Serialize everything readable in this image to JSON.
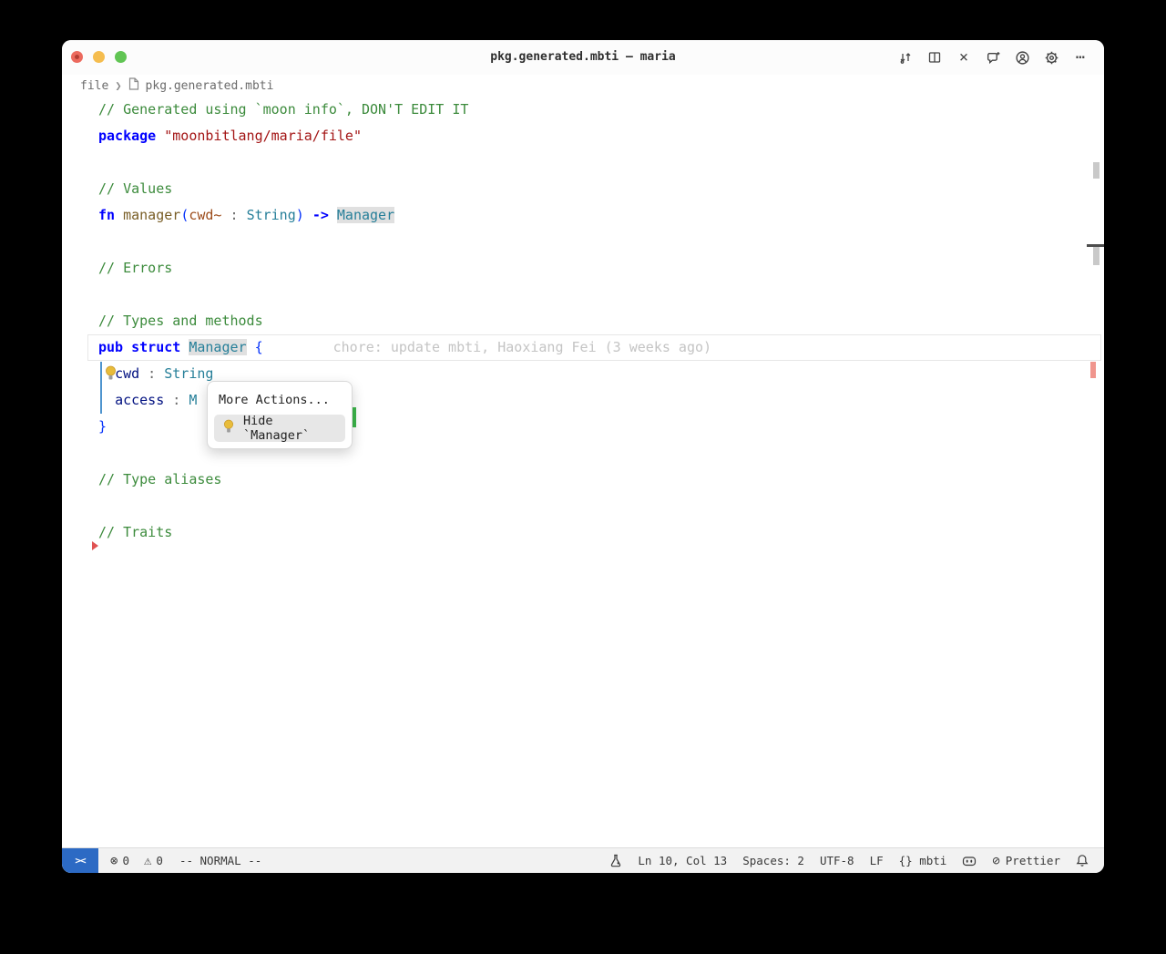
{
  "theme": {
    "window_bg": "#ffffff",
    "desktop_bg": "#000000",
    "statusbar_bg": "#f2f2f2",
    "remote_indicator_bg": "#2c6ac4",
    "word_highlight": "#e0e0e0",
    "current_line_border": "#e7e7e7",
    "popup_item_bg": "#e7e7e7",
    "traffic_red": "#ec6a5e",
    "traffic_yellow": "#f5bd4f",
    "traffic_green": "#61c554",
    "green_highlight": "#3cb54a",
    "overview_error_mark": "#f0958d"
  },
  "titlebar": {
    "title": "pkg.generated.mbti — maria",
    "icon_names": [
      "compare-changes",
      "split-editor",
      "close",
      "chat-add",
      "account",
      "settings",
      "more-actions"
    ]
  },
  "breadcrumb": {
    "folder": "file",
    "chevron": "❯",
    "file": "pkg.generated.mbti"
  },
  "editor": {
    "syntax_colors": {
      "comment": "#3c8b3c",
      "keyword": "#0000ff",
      "string": "#a31515",
      "func": "#795e26",
      "param": "#9c4c1b",
      "type": "#267f99",
      "field": "#001080",
      "punct": "#6a6a6a",
      "brace": "#0431fa",
      "op": "#0000ff",
      "plain": "#000000",
      "blame": "#c4c4c4"
    },
    "lines": [
      {
        "segments": [
          {
            "t": "// Generated using `moon info`, DON'T EDIT IT",
            "c": "comment"
          }
        ]
      },
      {
        "segments": [
          {
            "t": "package",
            "c": "keyword"
          },
          {
            "t": " ",
            "c": "plain"
          },
          {
            "t": "\"moonbitlang/maria/file\"",
            "c": "string"
          }
        ]
      },
      {
        "segments": []
      },
      {
        "segments": [
          {
            "t": "// Values",
            "c": "comment"
          }
        ]
      },
      {
        "segments": [
          {
            "t": "fn",
            "c": "keyword"
          },
          {
            "t": " ",
            "c": "plain"
          },
          {
            "t": "manager",
            "c": "func"
          },
          {
            "t": "(",
            "c": "brace"
          },
          {
            "t": "cwd~",
            "c": "param"
          },
          {
            "t": " : ",
            "c": "punct"
          },
          {
            "t": "String",
            "c": "type"
          },
          {
            "t": ")",
            "c": "brace"
          },
          {
            "t": " ",
            "c": "plain"
          },
          {
            "t": "->",
            "c": "op"
          },
          {
            "t": " ",
            "c": "plain"
          },
          {
            "t": "Manager",
            "c": "type",
            "hl": true
          }
        ]
      },
      {
        "segments": []
      },
      {
        "segments": [
          {
            "t": "// Errors",
            "c": "comment"
          }
        ]
      },
      {
        "segments": []
      },
      {
        "segments": [
          {
            "t": "// Types and methods",
            "c": "comment"
          }
        ]
      },
      {
        "segments": [
          {
            "t": "pub struct",
            "c": "keyword"
          },
          {
            "t": " ",
            "c": "plain"
          },
          {
            "t": "Manager",
            "c": "type",
            "hl": true
          },
          {
            "t": " ",
            "c": "plain"
          },
          {
            "t": "{",
            "c": "brace"
          },
          {
            "t": "chore: update mbti, Haoxiang Fei (3 weeks ago)",
            "c": "blame",
            "gap": 77
          }
        ]
      },
      {
        "segments": [
          {
            "t": "  ",
            "c": "plain"
          },
          {
            "t": "cwd",
            "c": "field"
          },
          {
            "t": " : ",
            "c": "punct"
          },
          {
            "t": "String",
            "c": "type"
          }
        ]
      },
      {
        "segments": [
          {
            "t": "  ",
            "c": "plain"
          },
          {
            "t": "access",
            "c": "field"
          },
          {
            "t": " : ",
            "c": "punct"
          },
          {
            "t": "M",
            "c": "type"
          }
        ]
      },
      {
        "segments": [
          {
            "t": "}",
            "c": "brace"
          }
        ]
      },
      {
        "segments": []
      },
      {
        "segments": [
          {
            "t": "// Type aliases",
            "c": "comment"
          }
        ]
      },
      {
        "segments": []
      },
      {
        "segments": [
          {
            "t": "// Traits",
            "c": "comment"
          }
        ]
      }
    ],
    "cursor_line": 10
  },
  "popup": {
    "title": "More Actions...",
    "item": "Hide `Manager`"
  },
  "statusbar": {
    "remote_glyph": "><",
    "problems": {
      "errors_icon": "⊗",
      "errors": "0",
      "warnings_icon": "⚠",
      "warnings": "0"
    },
    "mode": "-- NORMAL --",
    "right": [
      {
        "name": "flask",
        "label": ""
      },
      {
        "name": "cursor-position",
        "label": "Ln 10, Col 13"
      },
      {
        "name": "indentation",
        "label": "Spaces: 2"
      },
      {
        "name": "encoding",
        "label": "UTF-8"
      },
      {
        "name": "eol",
        "label": "LF"
      },
      {
        "name": "language-mode",
        "label": "{} mbti"
      },
      {
        "name": "copilot",
        "label": ""
      },
      {
        "name": "prettier",
        "label": "Prettier",
        "icon_glyph": "⊘"
      },
      {
        "name": "notifications",
        "label": ""
      }
    ]
  }
}
